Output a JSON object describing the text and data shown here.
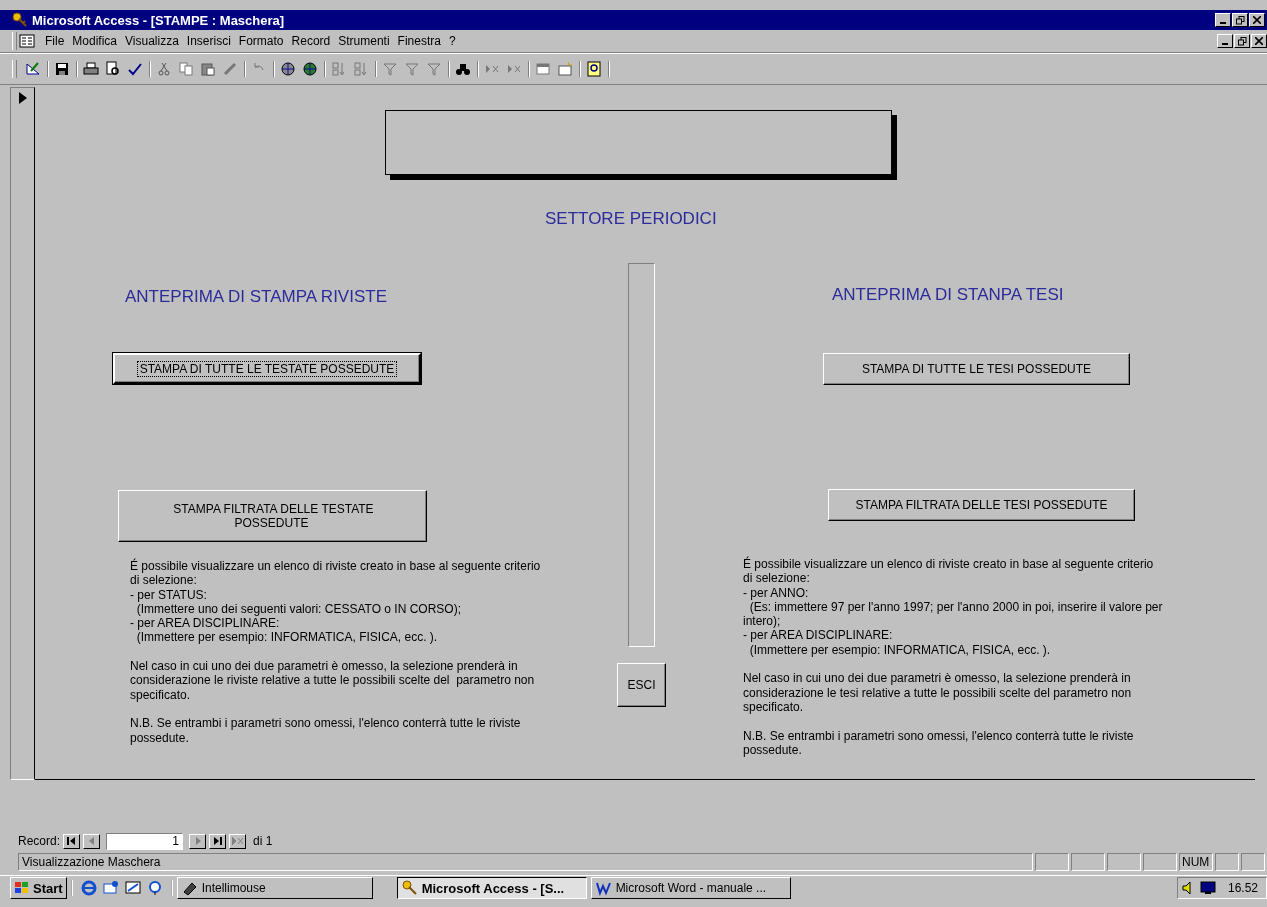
{
  "window": {
    "title": "Microsoft Access - [STAMPE : Maschera]"
  },
  "menu": [
    "File",
    "Modifica",
    "Visualizza",
    "Inserisci",
    "Formato",
    "Record",
    "Strumenti",
    "Finestra",
    "?"
  ],
  "form": {
    "heading": "SETTORE PERIODICI",
    "sections": [
      {
        "heading": "ANTEPRIMA DI STAMPA RIVISTE",
        "buttons": [
          {
            "label": "STAMPA DI TUTTE LE TESTATE POSSEDUTE",
            "focused": true
          },
          {
            "label": "STAMPA FILTRATA DELLE TESTATE\nPOSSEDUTE",
            "focused": false
          }
        ],
        "description": "É possibile visualizzare un elenco di riviste creato in base al seguente criterio\ndi selezione:\n- per STATUS:\n  (Immettere uno dei seguenti valori: CESSATO o IN CORSO);\n- per AREA DISCIPLINARE:\n  (Immettere per esempio: INFORMATICA, FISICA, ecc. ).\n\nNel caso in cui uno dei due parametri è omesso, la selezione prenderà in\nconsiderazione le riviste relative a tutte le possibili scelte del  parametro non\nspecificato.\n\nN.B. Se entrambi i parametri sono omessi, l'elenco conterrà tutte le riviste\npossedute."
      },
      {
        "heading": "ANTEPRIMA DI STANPA TESI",
        "buttons": [
          {
            "label": "STAMPA DI TUTTE LE TESI POSSEDUTE",
            "focused": false
          },
          {
            "label": "STAMPA FILTRATA DELLE TESI POSSEDUTE",
            "focused": false
          }
        ],
        "description": "É possibile visualizzare un elenco di riviste creato in base al seguente criterio\ndi selezione:\n- per ANNO:\n  (Es: immettere 97 per l'anno 1997; per l'anno 2000 in poi, inserire il valore per\nintero);\n- per AREA DISCIPLINARE:\n  (Immettere per esempio: INFORMATICA, FISICA, ecc. ).\n\nNel caso in cui uno dei due parametri è omesso, la selezione prenderà in\nconsiderazione le tesi relative a tutte le possibili scelte del parametro non\nspecificato.\n\nN.B. Se entrambi i parametri sono omessi, l'elenco conterrà tutte le riviste\npossedute."
      }
    ],
    "exit_button": "ESCI"
  },
  "record_nav": {
    "label": "Record:",
    "value": "1",
    "total": "di 1"
  },
  "status_bar": {
    "text": "Visualizzazione Maschera",
    "indicators": [
      {
        "label": "NUM"
      }
    ]
  },
  "taskbar": {
    "start": "Start",
    "tasks": [
      {
        "label": "Intellimouse",
        "selected": false
      },
      {
        "label": "Microsoft Access - [S...",
        "selected": true
      },
      {
        "label": "Microsoft Word - manuale ...",
        "selected": false
      }
    ],
    "clock": "16.52"
  }
}
